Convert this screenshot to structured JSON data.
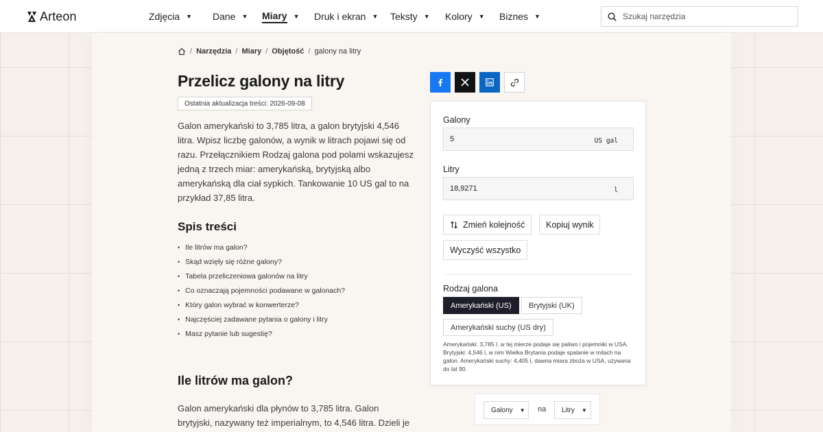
{
  "header": {
    "logo_text": "Arteon",
    "nav": [
      {
        "label": "Zdjęcia",
        "active": false
      },
      {
        "label": "Dane",
        "active": false
      },
      {
        "label": "Miary",
        "active": true
      },
      {
        "label": "Druk i ekran",
        "active": false
      },
      {
        "label": "Teksty",
        "active": false
      },
      {
        "label": "Kolory",
        "active": false
      },
      {
        "label": "Biznes",
        "active": false
      }
    ],
    "search_placeholder": "Szukaj narzędzia"
  },
  "breadcrumb": [
    "Narzędzia",
    "Miary",
    "Objętość",
    "galony na litry"
  ],
  "title": "Przelicz galony na litry",
  "updated": "Ostatnia aktualizacja treści: 2026-09-08",
  "intro": "Galon amerykański to 3,785 litra, a galon brytyjski 4,546 litra. Wpisz liczbę galonów, a wynik w litrach pojawi się od razu. Przełącznikiem Rodzaj galona pod polami wskazujesz jedną z trzech miar: amerykańską, brytyjską albo amerykańską dla ciał sypkich. Tankowanie 10 US gal to na przykład 37,85 litra.",
  "toc": {
    "title": "Spis treści",
    "items": [
      "Ile litrów ma galon?",
      "Skąd wzięły się różne galony?",
      "Tabela przeliczeniowa galonów na litry",
      "Co oznaczają pojemności podawane w galonach?",
      "Który galon wybrać w konwerterze?",
      "Najczęściej zadawane pytania o galony i litry",
      "Masz pytanie lub sugestię?"
    ]
  },
  "section": {
    "heading": "Ile litrów ma galon?",
    "text": "Galon amerykański dla płynów to 3,785 litra. Galon brytyjski, nazywany też imperialnym, to 4,546 litra. Dzieli je"
  },
  "share": [
    "facebook-icon",
    "x-icon",
    "linkedin-icon",
    "link-icon"
  ],
  "converter": {
    "from_label": "Galony",
    "from_value": "5",
    "from_unit": "US gal",
    "to_label": "Litry",
    "to_value": "18,9271",
    "to_unit": "l",
    "swap_label": "Zmień kolejność",
    "copy_label": "Kopiuj wynik",
    "clear_label": "Wyczyść wszystko",
    "type_label": "Rodzaj galona",
    "types": [
      "Amerykański (US)",
      "Brytyjski (UK)",
      "Amerykański suchy (US dry)"
    ],
    "selected_type": "Amerykański (US)",
    "note": "Amerykański: 3,785 l, w tej mierze podaje się paliwo i pojemniki w USA. Brytyjski: 4,546 l, w nim Wielka Brytania podaje spalanie w milach na galon. Amerykański suchy: 4,405 l, dawna miara zboża w USA, używana do lat 90."
  },
  "unit_selector": {
    "from": "Galony",
    "joiner": "na",
    "to": "Litry"
  },
  "colors": {
    "facebook": "#1877f2",
    "x": "#121212",
    "linkedin": "#0a66c2",
    "selected_type": "#1e1e2a"
  }
}
